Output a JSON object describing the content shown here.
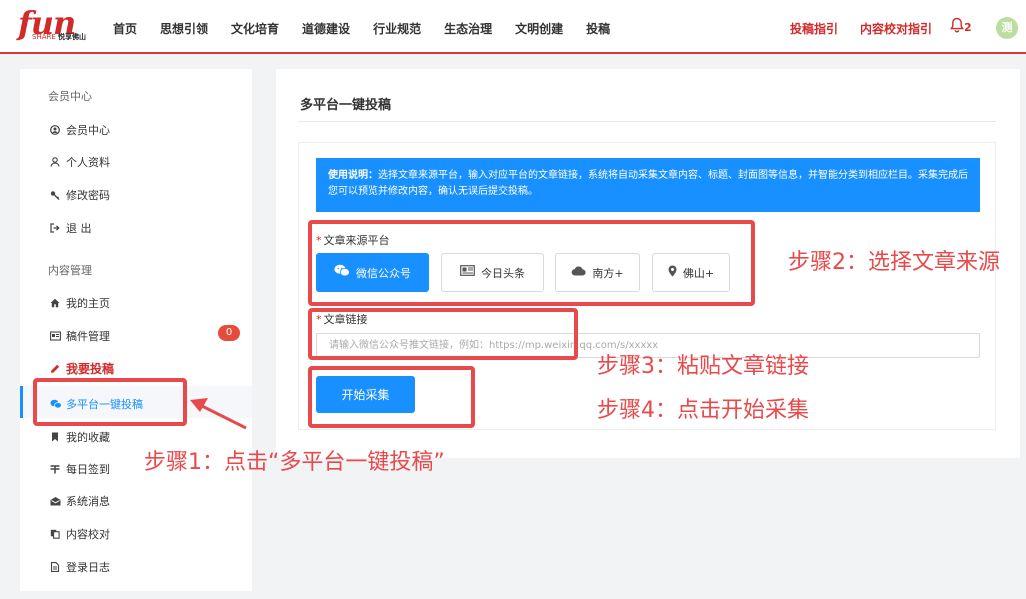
{
  "header": {
    "logo": {
      "main": "fun",
      "sub_en": "SHARE",
      "sub_cn": "悦享佛山"
    },
    "nav": [
      "首页",
      "思想引领",
      "文化培育",
      "道德建设",
      "行业规范",
      "生态治理",
      "文明创建",
      "投稿"
    ],
    "links": {
      "guide": "投稿指引",
      "proofread_guide": "内容校对指引"
    },
    "notification_count": "2",
    "avatar_text": "测"
  },
  "sidebar": {
    "member_section": "会员中心",
    "member_items": [
      {
        "label": "会员中心",
        "icon": "user-circle-icon"
      },
      {
        "label": "个人资料",
        "icon": "user-icon"
      },
      {
        "label": "修改密码",
        "icon": "key-icon"
      },
      {
        "label": "退 出",
        "icon": "logout-icon"
      }
    ],
    "content_section": "内容管理",
    "content_items": [
      {
        "label": "我的主页",
        "icon": "home-icon"
      },
      {
        "label": "稿件管理",
        "icon": "manuscript-icon",
        "badge": "0"
      },
      {
        "label": "我要投稿",
        "icon": "pencil-icon"
      },
      {
        "label": "多平台一键投稿",
        "icon": "wechat-icon"
      },
      {
        "label": "我的收藏",
        "icon": "bookmark-icon"
      },
      {
        "label": "每日签到",
        "icon": "signin-icon"
      },
      {
        "label": "系统消息",
        "icon": "envelope-icon"
      },
      {
        "label": "内容校对",
        "icon": "copy-icon"
      },
      {
        "label": "登录日志",
        "icon": "file-icon"
      }
    ]
  },
  "main": {
    "title": "多平台一键投稿",
    "notice_title": "使用说明：",
    "notice_text": "选择文章来源平台，输入对应平台的文章链接，系统将自动采集文章内容、标题、封面图等信息，并智能分类到相应栏目。采集完成后您可以预览并修改内容，确认无误后提交投稿。",
    "source_label": "文章来源平台",
    "platforms": [
      {
        "label": "微信公众号",
        "icon": "wechat-icon",
        "selected": true
      },
      {
        "label": "今日头条",
        "icon": "newspaper-icon",
        "selected": false
      },
      {
        "label": "南方+",
        "icon": "cloud-icon",
        "selected": false
      },
      {
        "label": "佛山+",
        "icon": "map-pin-icon",
        "selected": false
      }
    ],
    "link_label": "文章链接",
    "link_placeholder": "请输入微信公众号推文链接，例如：https://mp.weixin.qq.com/s/xxxxx",
    "start_button": "开始采集"
  },
  "annotations": {
    "step1": "步骤1：点击“多平台一键投稿”",
    "step2": "步骤2：选择文章来源",
    "step3": "步骤3：粘贴文章链接",
    "step4": "步骤4：点击开始采集"
  },
  "colors": {
    "brand_red": "#d12a2a",
    "primary_blue": "#1890ff",
    "annotation_red": "#e8494b"
  }
}
